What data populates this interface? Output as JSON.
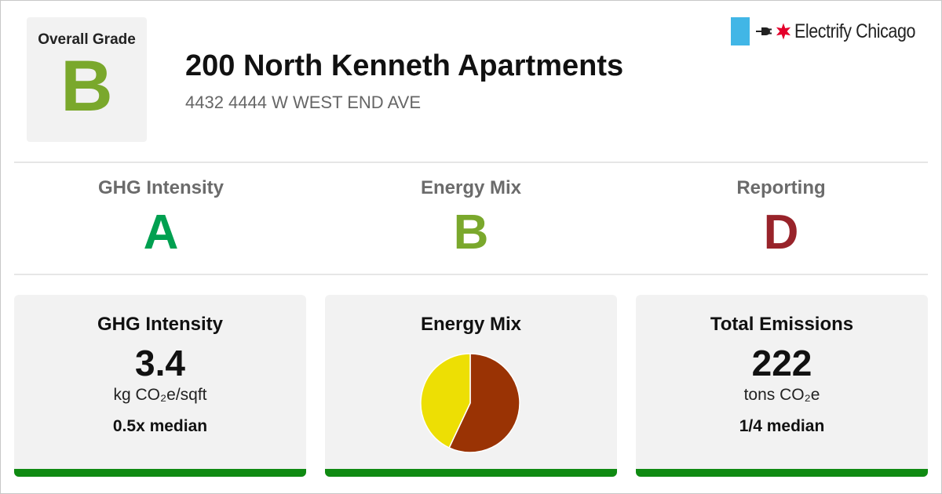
{
  "colors": {
    "grade_a": "#00a050",
    "grade_b": "#7aa82c",
    "grade_d": "#98232a",
    "bar_good": "#0f8a12"
  },
  "header": {
    "overall_grade_label": "Overall Grade",
    "overall_grade": "B",
    "building_name": "200 North Kenneth Apartments",
    "address": "4432 4444 W WEST END AVE"
  },
  "brand": {
    "name": "Electrify Chicago",
    "icons": [
      "chicago-flag-bar",
      "plug-icon",
      "chicago-star-icon"
    ]
  },
  "subgrades": [
    {
      "label": "GHG Intensity",
      "grade": "A"
    },
    {
      "label": "Energy Mix",
      "grade": "B"
    },
    {
      "label": "Reporting",
      "grade": "D"
    }
  ],
  "cards": {
    "ghg": {
      "title": "GHG Intensity",
      "value": "3.4",
      "unit": "kg CO₂e/sqft",
      "compare": "0.5x median"
    },
    "energy_mix": {
      "title": "Energy Mix"
    },
    "emissions": {
      "title": "Total Emissions",
      "value": "222",
      "unit": "tons CO₂e",
      "compare": "1/4 median"
    }
  },
  "chart_data": {
    "type": "pie",
    "title": "",
    "slices": [
      {
        "value": 0.57,
        "color": "#9a3304"
      },
      {
        "value": 0.43,
        "color": "#eddf04"
      }
    ]
  }
}
